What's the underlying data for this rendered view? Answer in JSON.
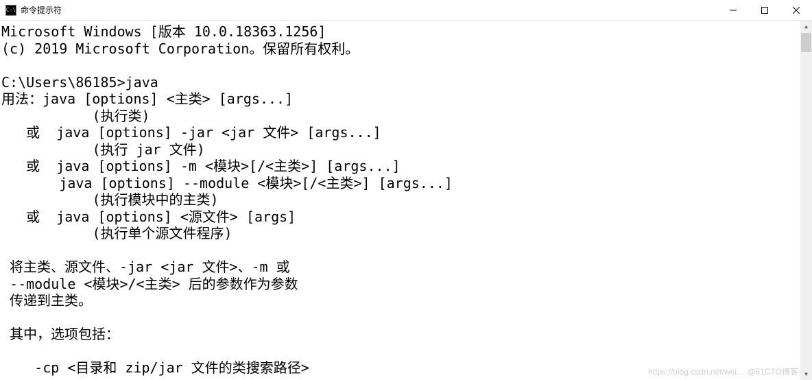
{
  "window": {
    "title": "命令提示符",
    "icon_text": "C:\\"
  },
  "terminal": {
    "lines": [
      "Microsoft Windows [版本 10.0.18363.1256]",
      "(c) 2019 Microsoft Corporation。保留所有权利。",
      "",
      "C:\\Users\\86185>java",
      "用法：java [options] <主类> [args...]",
      "           (执行类)",
      "   或  java [options] -jar <jar 文件> [args...]",
      "           (执行 jar 文件)",
      "   或  java [options] -m <模块>[/<主类>] [args...]",
      "       java [options] --module <模块>[/<主类>] [args...]",
      "           (执行模块中的主类)",
      "   或  java [options] <源文件> [args]",
      "           (执行单个源文件程序)",
      "",
      " 将主类、源文件、-jar <jar 文件>、-m 或",
      " --module <模块>/<主类> 后的参数作为参数",
      " 传递到主类。",
      "",
      " 其中，选项包括：",
      "",
      "    -cp <目录和 zip/jar 文件的类搜索路径>"
    ]
  },
  "watermark": "https://blog.csdn.net/wei…  @51CTO博客"
}
